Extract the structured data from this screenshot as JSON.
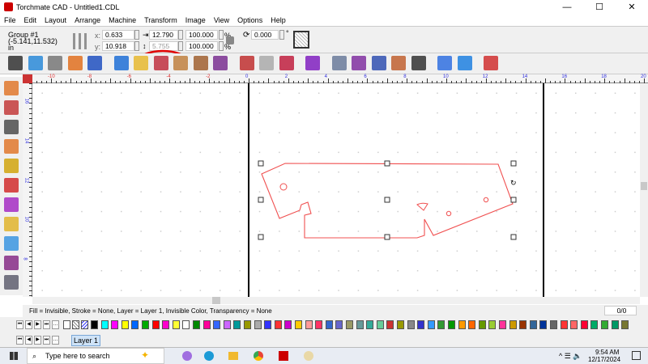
{
  "window": {
    "title": "Torchmate CAD - Untitled1.CDL",
    "minimize": "—",
    "maximize": "☐",
    "close": "✕"
  },
  "menu": [
    "File",
    "Edit",
    "Layout",
    "Arrange",
    "Machine",
    "Transform",
    "Image",
    "View",
    "Options",
    "Help"
  ],
  "props": {
    "object": "Group #1",
    "coords": "(-5.141,11.532)",
    "units": "in",
    "x_label": "x:",
    "x": "0.633",
    "y_label": "y:",
    "y": "10.918",
    "width": "12.790",
    "height": "5.755",
    "scale_x": "100.000",
    "scale_y": "100.000",
    "pct": "%",
    "rotation": "0.000",
    "deg": "°"
  },
  "toolbar_icons": [
    "move-icon",
    "select-node-icon",
    "rotate-icon",
    "mirror-icon",
    "weld-icon",
    "new-icon",
    "open-icon",
    "save-icon",
    "import-icon",
    "export-icon",
    "print-preview-icon",
    "undo-icon",
    "redo-icon",
    "exit-icon",
    "layer-icon",
    "toolpath-outline-icon",
    "toolpath-pocket-icon",
    "toolpath-drill-icon",
    "toolpath-engrave-icon",
    "lead-icon",
    "simulate-icon",
    "post-icon",
    "cut-icon"
  ],
  "left_tools": [
    "pointer-icon",
    "node-edit-icon",
    "draw-icon",
    "text-icon",
    "zoom-icon",
    "fill-icon",
    "shape-icon",
    "pen-icon",
    "paint-icon",
    "eyedropper-icon",
    "toolpath-icon"
  ],
  "hruler": [
    "-10",
    "-8",
    "-6",
    "-4",
    "-2",
    "0",
    "2",
    "4",
    "6",
    "8",
    "10",
    "12",
    "14",
    "16",
    "18",
    "20"
  ],
  "vruler": [
    "16",
    "14",
    "12",
    "10",
    "8"
  ],
  "status": {
    "text": "Fill = Invisible, Stroke = None, Layer = Layer 1, Invisible Color, Transparency = None",
    "page": "0/0"
  },
  "palette": [
    "#000000",
    "#00ffff",
    "#ff00ff",
    "#ffff00",
    "#0066ff",
    "#00aa00",
    "#ff0000",
    "#ff00cc",
    "#ffff33",
    "#ffffff",
    "#008800",
    "#ff0099",
    "#3366ff",
    "#cc66ff",
    "#009999",
    "#999900",
    "#aaaaaa",
    "#3333ff",
    "#ff3333",
    "#cc00cc",
    "#ffcc00",
    "#ff9999",
    "#ff3366",
    "#3366cc",
    "#6666cc",
    "#999966",
    "#669999",
    "#33aa99",
    "#66cc99",
    "#cc3333",
    "#999900",
    "#888888",
    "#3333cc",
    "#3399ff",
    "#339933",
    "#009900",
    "#ff9900",
    "#ff6600",
    "#669900",
    "#99cc33",
    "#ff3399",
    "#cc9900",
    "#993300",
    "#336699",
    "#003399",
    "#666666",
    "#ff3333",
    "#ff6666",
    "#ff0033",
    "#00aa66",
    "#33aa33",
    "#009966",
    "#777733"
  ],
  "layer": {
    "name": "Layer 1"
  },
  "taskbar": {
    "search": "Type here to search",
    "time": "9:54 AM",
    "date": "12/17/2024"
  },
  "colors": {
    "shape": "#f05050",
    "annotation": "#e00000"
  }
}
